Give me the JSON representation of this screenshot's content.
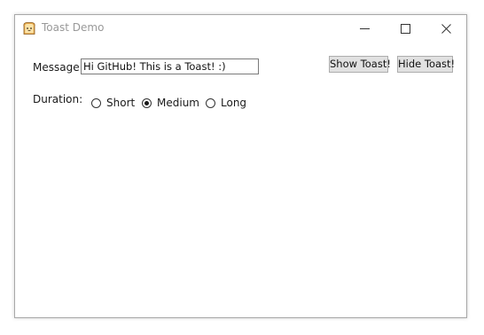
{
  "window": {
    "title": "Toast Demo",
    "icon": "toast-icon"
  },
  "title_controls": {
    "minimize": "minimize-icon",
    "maximize": "maximize-icon",
    "close": "close-icon"
  },
  "form": {
    "message_label": "Message:",
    "message_value": "Hi GitHub! This is a Toast! :)",
    "duration_label": "Duration:",
    "duration_options": [
      {
        "label": "Short",
        "checked": false
      },
      {
        "label": "Medium",
        "checked": true
      },
      {
        "label": "Long",
        "checked": false
      }
    ]
  },
  "buttons": {
    "show": "Show Toast!",
    "hide": "Hide Toast!"
  },
  "colors": {
    "title_text": "#999999",
    "button_bg": "#e1e1e1",
    "button_border": "#adadad",
    "window_border": "#a8a8a8"
  }
}
